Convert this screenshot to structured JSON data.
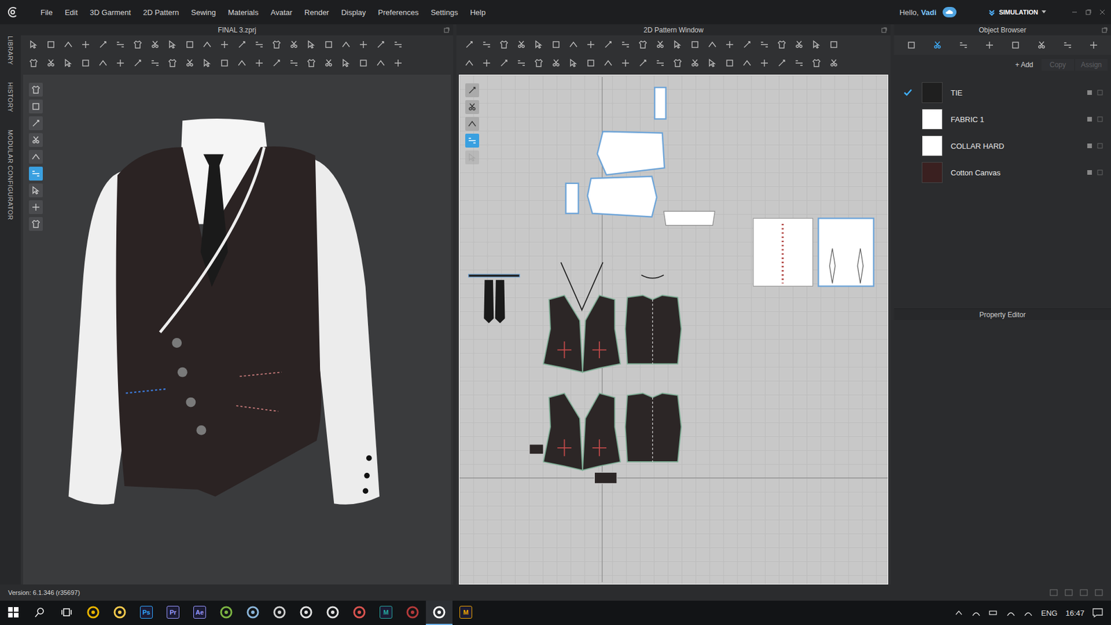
{
  "menu": [
    "File",
    "Edit",
    "3D Garment",
    "2D Pattern",
    "Sewing",
    "Materials",
    "Avatar",
    "Render",
    "Display",
    "Preferences",
    "Settings",
    "Help"
  ],
  "user": {
    "greeting": "Hello,",
    "name": "Vadi"
  },
  "mode": {
    "label": "SIMULATION"
  },
  "side_tabs": [
    {
      "label": "LIBRARY"
    },
    {
      "label": "HISTORY"
    },
    {
      "label": "MODULAR CONFIGURATOR"
    }
  ],
  "viewport_3d": {
    "title": "FINAL 3.zprj",
    "side_tools": [
      {
        "selected": false
      },
      {
        "selected": false
      },
      {
        "selected": false
      },
      {
        "selected": false
      },
      {
        "selected": false
      },
      {
        "selected": true
      },
      {
        "selected": false
      },
      {
        "selected": false
      },
      {
        "selected": false
      }
    ]
  },
  "viewport_2d": {
    "title": "2D Pattern Window",
    "side_tools": [
      {
        "selected": false,
        "disabled": false
      },
      {
        "selected": false,
        "disabled": false
      },
      {
        "selected": false,
        "disabled": false
      },
      {
        "selected": true,
        "disabled": false
      },
      {
        "selected": false,
        "disabled": true
      }
    ]
  },
  "object_browser": {
    "title": "Object Browser",
    "tabs": [
      {
        "selected": false
      },
      {
        "selected": true
      },
      {
        "selected": false
      },
      {
        "selected": false
      },
      {
        "selected": false
      },
      {
        "selected": false
      },
      {
        "selected": false
      },
      {
        "selected": false
      }
    ],
    "actions": [
      {
        "icon": "+",
        "label": "Add",
        "disabled": false
      },
      {
        "label": "Copy",
        "disabled": true
      },
      {
        "label": "Assign",
        "disabled": true
      }
    ],
    "items": [
      {
        "name": "TIE",
        "selected": true,
        "color": "#1f1f1f"
      },
      {
        "name": "FABRIC 1",
        "selected": false,
        "color": "#ffffff"
      },
      {
        "name": "COLLAR HARD",
        "selected": false,
        "color": "#ffffff"
      },
      {
        "name": "Cotton Canvas",
        "selected": false,
        "color": "#3a2020"
      }
    ]
  },
  "property_editor": {
    "title": "Property Editor"
  },
  "status_bar": {
    "version": "Version: 6.1.346 (r35697)"
  },
  "taskbar": {
    "language": "ENG",
    "time": "16:47",
    "apps": [
      {
        "kind": "glyph",
        "color": "#e8b400",
        "selected": false
      },
      {
        "kind": "glyph",
        "color": "#f2c94c",
        "selected": false
      },
      {
        "kind": "letter",
        "label": "Ps",
        "color": "#31a8ff",
        "selected": false
      },
      {
        "kind": "letter",
        "label": "Pr",
        "color": "#9999ff",
        "selected": false
      },
      {
        "kind": "letter",
        "label": "Ae",
        "color": "#9999ff",
        "selected": false
      },
      {
        "kind": "glyph",
        "color": "#7cb342",
        "selected": false
      },
      {
        "kind": "glyph",
        "color": "#8ab4d8",
        "selected": false
      },
      {
        "kind": "glyph",
        "color": "#d0d0d0",
        "selected": false
      },
      {
        "kind": "glyph",
        "color": "#e0e0e0",
        "selected": false
      },
      {
        "kind": "glyph",
        "color": "#e0e0e0",
        "selected": false
      },
      {
        "kind": "glyph",
        "color": "#d9534f",
        "selected": false
      },
      {
        "kind": "letter",
        "label": "M",
        "color": "#27a9a1",
        "selected": false
      },
      {
        "kind": "glyph",
        "color": "#b33a3a",
        "selected": false
      },
      {
        "kind": "glyph",
        "color": "#ffffff",
        "selected": true
      },
      {
        "kind": "letter",
        "label": "M",
        "color": "#f0a500",
        "selected": false
      }
    ]
  }
}
